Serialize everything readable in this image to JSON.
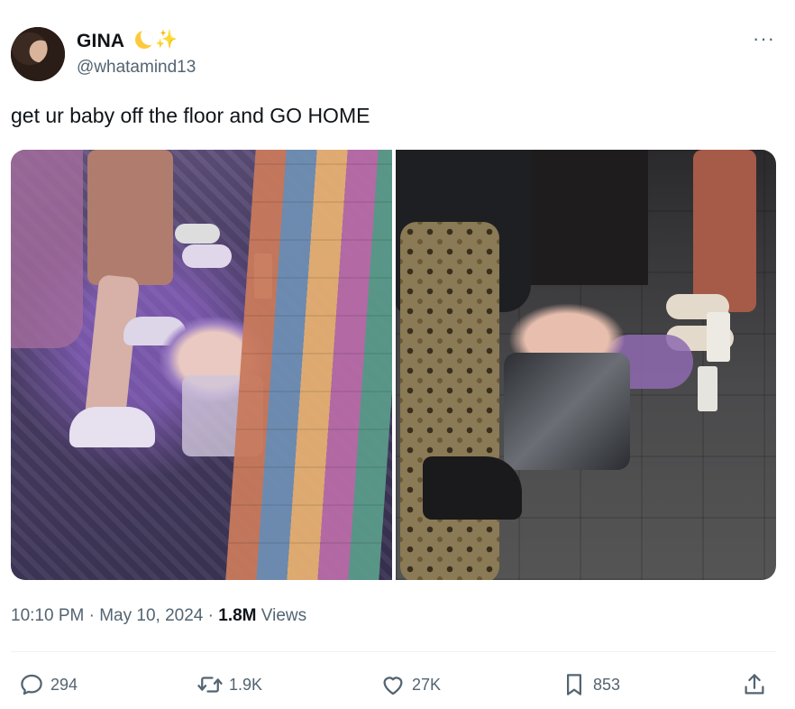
{
  "author": {
    "display_name": "GINA",
    "emoji_icons": [
      "crescent-moon-icon",
      "sparkles-icon"
    ],
    "handle": "@whatamind13"
  },
  "tweet": {
    "text": "get ur baby off the floor and GO HOME",
    "media": [
      {
        "name": "photo-left",
        "kind": "photo"
      },
      {
        "name": "photo-right",
        "kind": "photo"
      }
    ]
  },
  "meta": {
    "time": "10:10 PM",
    "separator": "·",
    "date": "May 10, 2024",
    "views_count": "1.8M",
    "views_label": "Views"
  },
  "actions": {
    "replies": "294",
    "retweets": "1.9K",
    "likes": "27K",
    "bookmarks": "853"
  },
  "icons": {
    "more": "more-icon",
    "reply": "reply-icon",
    "retweet": "retweet-icon",
    "like": "heart-icon",
    "bookmark": "bookmark-icon",
    "share": "share-icon"
  },
  "colors": {
    "text_primary": "#0f1419",
    "text_secondary": "#536471",
    "divider": "#eff3f4"
  }
}
